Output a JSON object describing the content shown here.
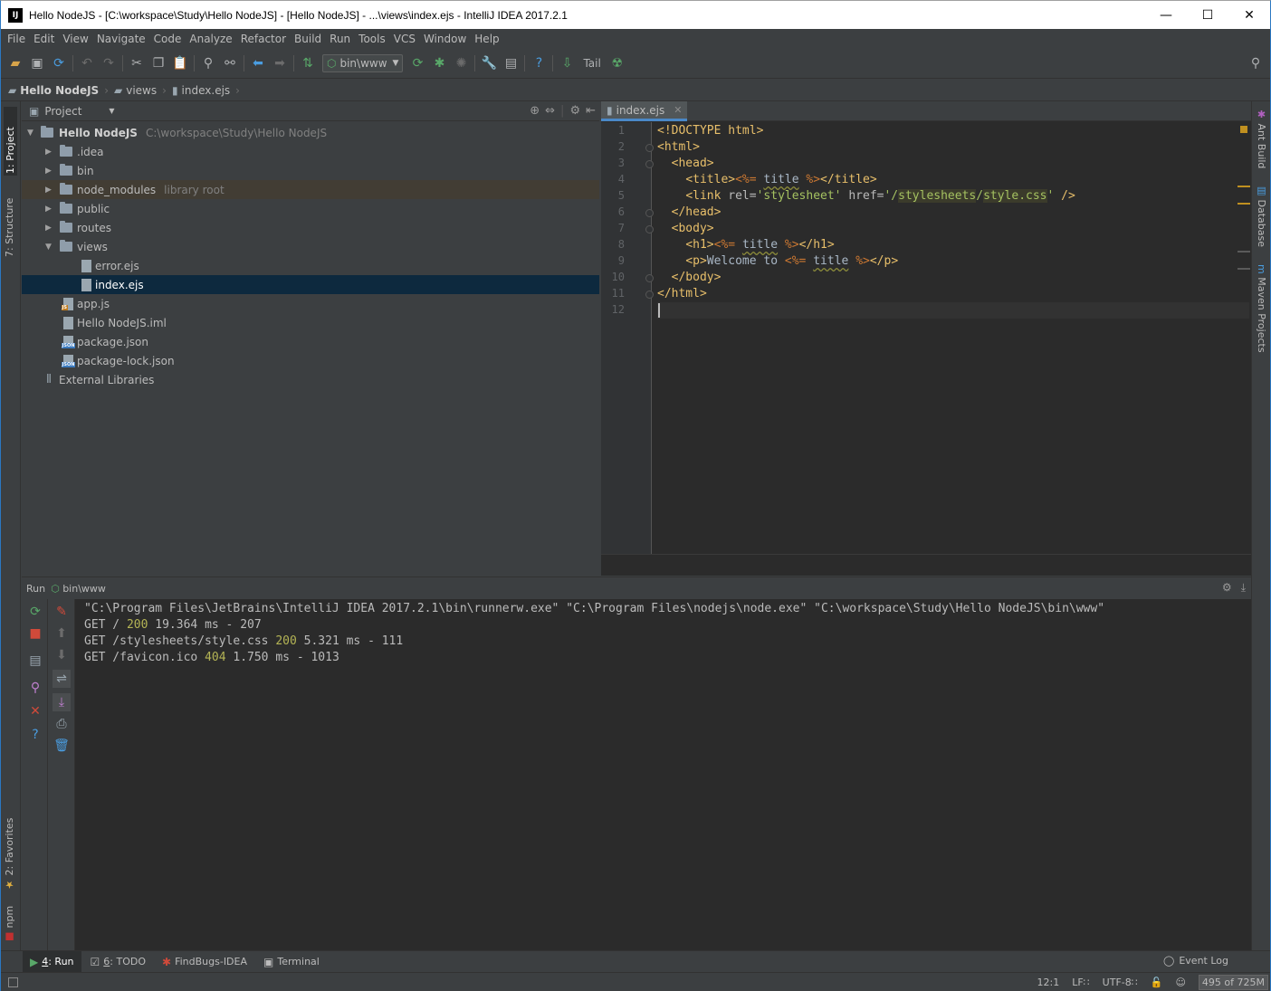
{
  "window": {
    "title": "Hello NodeJS - [C:\\workspace\\Study\\Hello NodeJS] - [Hello NodeJS] - ...\\views\\index.ejs - IntelliJ IDEA 2017.2.1",
    "app_icon": "IJ",
    "minimize": "—",
    "maximize": "☐",
    "close": "✕"
  },
  "menu": [
    "File",
    "Edit",
    "View",
    "Navigate",
    "Code",
    "Analyze",
    "Refactor",
    "Build",
    "Run",
    "Tools",
    "VCS",
    "Window",
    "Help"
  ],
  "toolbar": {
    "run_config": "bin\\www",
    "tail_label": "Tail"
  },
  "breadcrumb": [
    "Hello NodeJS",
    "views",
    "index.ejs"
  ],
  "left_tabs": {
    "project": "1: Project",
    "structure": "7: Structure",
    "favorites": "2: Favorites",
    "npm": "npm"
  },
  "right_tabs": {
    "ant": "Ant Build",
    "database": "Database",
    "maven": "Maven Projects"
  },
  "project_panel": {
    "title": "Project",
    "tree": [
      {
        "label": "Hello NodeJS",
        "sub": "C:\\workspace\\Study\\Hello NodeJS",
        "depth": 0,
        "kind": "module",
        "expanded": true
      },
      {
        "label": ".idea",
        "depth": 1,
        "kind": "folder",
        "expanded": false
      },
      {
        "label": "bin",
        "depth": 1,
        "kind": "folder",
        "expanded": false
      },
      {
        "label": "node_modules",
        "sub": "library root",
        "depth": 1,
        "kind": "folder",
        "expanded": false
      },
      {
        "label": "public",
        "depth": 1,
        "kind": "folder",
        "expanded": false
      },
      {
        "label": "routes",
        "depth": 1,
        "kind": "folder",
        "expanded": false
      },
      {
        "label": "views",
        "depth": 1,
        "kind": "folder",
        "expanded": true
      },
      {
        "label": "error.ejs",
        "depth": 2,
        "kind": "ejs"
      },
      {
        "label": "index.ejs",
        "depth": 2,
        "kind": "ejs"
      },
      {
        "label": "app.js",
        "depth": 1,
        "kind": "js"
      },
      {
        "label": "Hello NodeJS.iml",
        "depth": 1,
        "kind": "iml"
      },
      {
        "label": "package.json",
        "depth": 1,
        "kind": "json"
      },
      {
        "label": "package-lock.json",
        "depth": 1,
        "kind": "json"
      },
      {
        "label": "External Libraries",
        "depth": 0,
        "kind": "libs"
      }
    ]
  },
  "editor": {
    "tab": "index.ejs",
    "lines": [
      "1",
      "2",
      "3",
      "4",
      "5",
      "6",
      "7",
      "8",
      "9",
      "10",
      "11",
      "12"
    ],
    "code": {
      "l1": "<!DOCTYPE html>",
      "l2_tag": "<html>",
      "l3_tag": "<head>",
      "l4_open": "<title>",
      "l4_ejs_open": "<%=",
      "l4_var": "title",
      "l4_ejs_close": "%>",
      "l4_close": "</title>",
      "l5_open": "<link",
      "l5_attr1": "rel=",
      "l5_val1": "'stylesheet'",
      "l5_attr2": "href=",
      "l5_q1": "'/",
      "l5_seg1": "stylesheets",
      "l5_sl": "/",
      "l5_seg2": "style.css",
      "l5_q2": "'",
      "l5_end": "/>",
      "l6_tag": "</head>",
      "l7_tag": "<body>",
      "l8_open": "<h1>",
      "l8_ejs_open": "<%=",
      "l8_var": "title",
      "l8_ejs_close": "%>",
      "l8_close": "</h1>",
      "l9_open": "<p>",
      "l9_text": "Welcome to",
      "l9_ejs_open": "<%=",
      "l9_var": "title",
      "l9_ejs_close": "%>",
      "l9_close": "</p>",
      "l10_tag": "</body>",
      "l11_tag": "</html>"
    }
  },
  "run_panel": {
    "label": "Run",
    "config": "bin\\www",
    "console": {
      "cmd": "\"C:\\Program Files\\JetBrains\\IntelliJ IDEA 2017.2.1\\bin\\runnerw.exe\" \"C:\\Program Files\\nodejs\\node.exe\" \"C:\\workspace\\Study\\Hello NodeJS\\bin\\www\"",
      "r1_pre": "GET / ",
      "r1_code": "200",
      "r1_post": " 19.364 ms - 207",
      "r2_pre": "GET /stylesheets/style.css ",
      "r2_code": "200",
      "r2_post": " 5.321 ms - 111",
      "r3_pre": "GET /favicon.ico ",
      "r3_code": "404",
      "r3_post": " 1.750 ms - 1013"
    }
  },
  "bottom_tabs": [
    {
      "key": "run",
      "mnemonic": "4",
      "label": ": Run"
    },
    {
      "key": "todo",
      "mnemonic": "6",
      "label": ": TODO"
    },
    {
      "key": "findbugs",
      "label": "FindBugs-IDEA"
    },
    {
      "key": "terminal",
      "label": "Terminal"
    }
  ],
  "event_log": "Event Log",
  "status": {
    "position": "12:1",
    "line_sep": "LF∷",
    "encoding": "UTF-8∷",
    "memory": "495 of 725M"
  },
  "colors": {
    "selection": "#0d293e",
    "accent": "#4a88c7",
    "tag": "#e8bf6a",
    "string": "#a5c261"
  }
}
